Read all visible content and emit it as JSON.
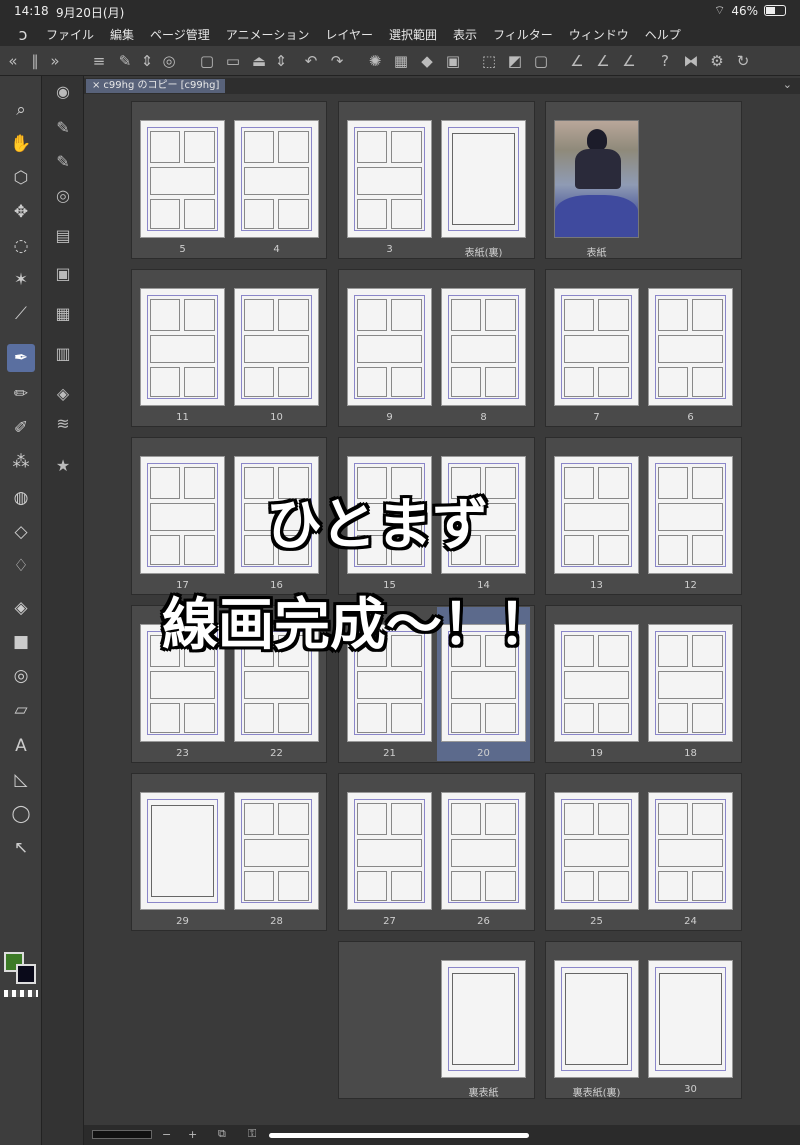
{
  "status": {
    "time": "14:18",
    "date": "9月20日(月)",
    "battery": "46%"
  },
  "menu": [
    "ファイル",
    "編集",
    "ページ管理",
    "アニメーション",
    "レイヤー",
    "選択範囲",
    "表示",
    "フィルター",
    "ウィンドウ",
    "ヘルプ"
  ],
  "tab": {
    "title": "c99hg のコピー [c99hg]"
  },
  "overlay": {
    "line1": "ひとまず",
    "line2": "線画完成〜！！"
  },
  "pages": {
    "p5": "5",
    "p4": "4",
    "p3": "3",
    "back_cover_inside": "表紙(裏)",
    "cover": "表紙",
    "p11": "11",
    "p10": "10",
    "p9": "9",
    "p8": "8",
    "p7": "7",
    "p6": "6",
    "p17": "17",
    "p16": "16",
    "p15": "15",
    "p14": "14",
    "p13": "13",
    "p12": "12",
    "p23": "23",
    "p22": "22",
    "p21": "21",
    "p20": "20",
    "p19": "19",
    "p18": "18",
    "p29": "29",
    "p28": "28",
    "p27": "27",
    "p26": "26",
    "p25": "25",
    "p24": "24",
    "back_cover": "裏表紙",
    "back_cover_reverse": "裏表紙(裏)",
    "p30": "30"
  },
  "colors": {
    "main": "#3c7a26",
    "sub": "#0a0a1a",
    "accent": "#5a6fa0"
  },
  "bottom": {
    "minus": "−",
    "plus": "+"
  }
}
